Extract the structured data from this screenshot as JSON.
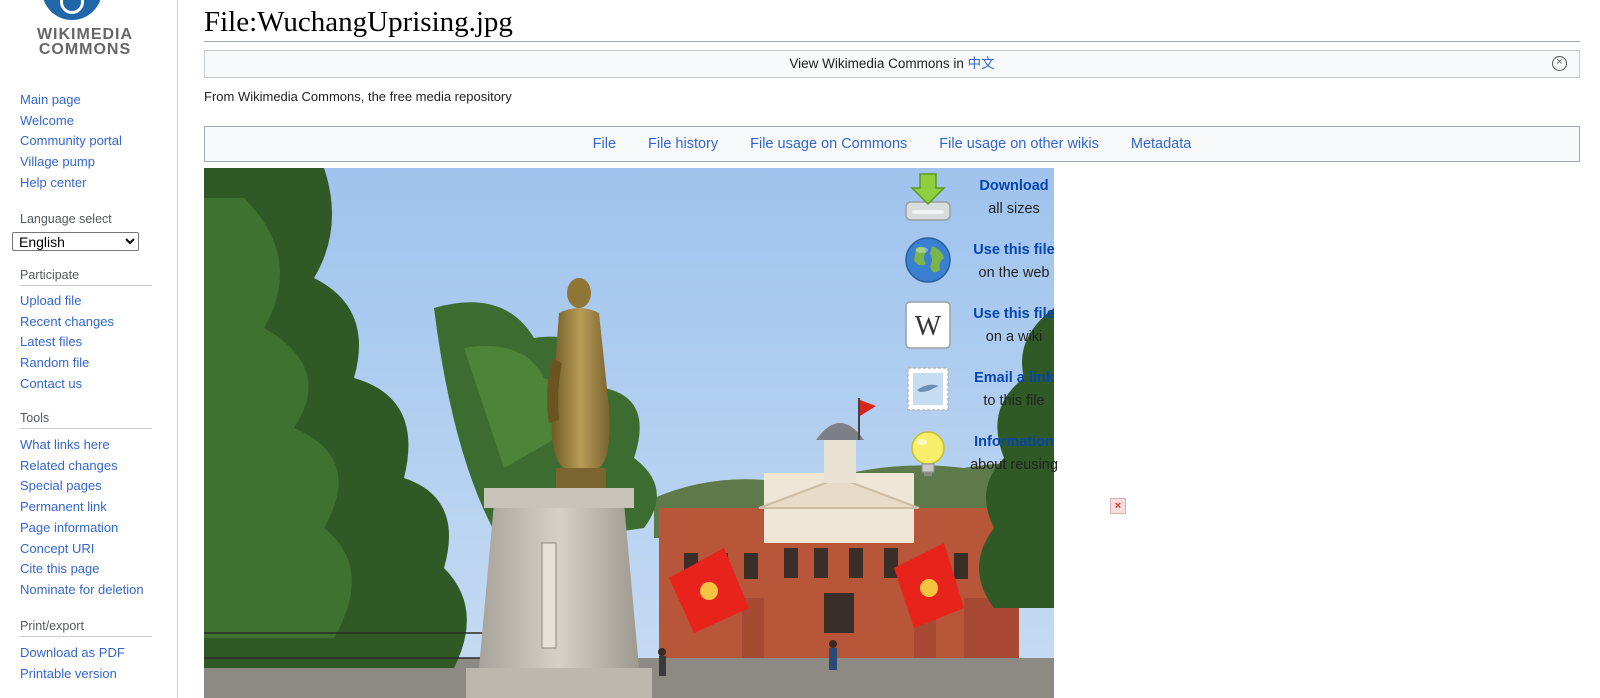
{
  "logo": {
    "line1": "WIKIMEDIA",
    "line2": "COMMONS"
  },
  "sidebar": {
    "nav": [
      "Main page",
      "Welcome",
      "Community portal",
      "Village pump",
      "Help center"
    ],
    "language_select": {
      "heading": "Language select",
      "selected": "English"
    },
    "participate": {
      "heading": "Participate",
      "items": [
        "Upload file",
        "Recent changes",
        "Latest files",
        "Random file",
        "Contact us"
      ]
    },
    "tools": {
      "heading": "Tools",
      "items": [
        "What links here",
        "Related changes",
        "Special pages",
        "Permanent link",
        "Page information",
        "Concept URI",
        "Cite this page",
        "Nominate for deletion"
      ]
    },
    "print_export": {
      "heading": "Print/export",
      "items": [
        "Download as PDF",
        "Printable version"
      ]
    }
  },
  "page": {
    "title": "File:WuchangUprising.jpg",
    "lang_notice": {
      "text": "View Wikimedia Commons in ",
      "lang_link": "中文",
      "close_icon": "close-circle-icon"
    },
    "site_sub": "From Wikimedia Commons, the free media repository",
    "tabs": [
      "File",
      "File history",
      "File usage on Commons",
      "File usage on other wikis",
      "Metadata"
    ]
  },
  "reuse": [
    {
      "title": "Download",
      "sub": "all sizes",
      "icon": "download-icon"
    },
    {
      "title": "Use this file",
      "sub": "on the web",
      "icon": "globe-icon"
    },
    {
      "title": "Use this file",
      "sub": "on a wiki",
      "icon": "wikipedia-icon"
    },
    {
      "title": "Email a link",
      "sub": "to this file",
      "icon": "email-stamp-icon"
    },
    {
      "title": "Information",
      "sub": "about reusing",
      "icon": "lightbulb-icon"
    }
  ],
  "colors": {
    "link": "#3366cc",
    "reuse_link": "#0645ad",
    "sidebar_border": "#a7d7f9",
    "flag_red": "#e8231b"
  }
}
